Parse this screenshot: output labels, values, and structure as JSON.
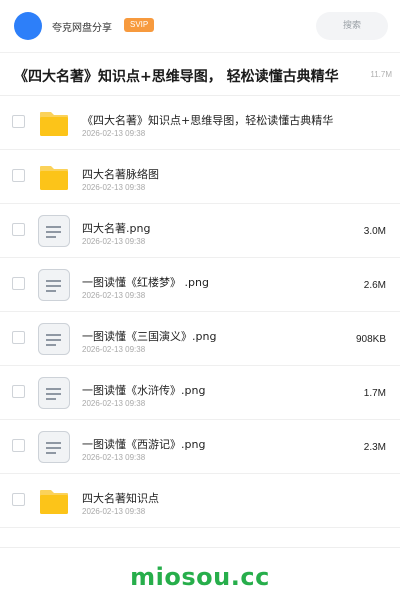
{
  "header": {
    "share_name": "夸克网盘分享",
    "badge": "SVIP",
    "search_label": "搜索"
  },
  "title": {
    "text": "《四大名著》知识点+思维导图， 轻松读懂古典精华",
    "size": "11.7M"
  },
  "files": [
    {
      "type": "folder",
      "name": "《四大名著》知识点+思维导图，轻松读懂古典精华",
      "date": "2026-02-13 09:38",
      "size": ""
    },
    {
      "type": "folder",
      "name": "四大名著脉络图",
      "date": "2026-02-13 09:38",
      "size": ""
    },
    {
      "type": "file",
      "name": "四大名著.png",
      "date": "2026-02-13 09:38",
      "size": "3.0M"
    },
    {
      "type": "file",
      "name": "一图读懂《红楼梦》 .png",
      "date": "2026-02-13 09:38",
      "size": "2.6M"
    },
    {
      "type": "file",
      "name": "一图读懂《三国演义》.png",
      "date": "2026-02-13 09:38",
      "size": "908KB"
    },
    {
      "type": "file",
      "name": "一图读懂《水浒传》.png",
      "date": "2026-02-13 09:38",
      "size": "1.7M"
    },
    {
      "type": "file",
      "name": "一图读懂《西游记》.png",
      "date": "2026-02-13 09:38",
      "size": "2.3M"
    },
    {
      "type": "folder",
      "name": "四大名著知识点",
      "date": "2026-02-13 09:38",
      "size": ""
    }
  ],
  "icons": {
    "folder": "folder-icon",
    "file": "document-icon"
  },
  "colors": {
    "accent": "#2d7ff9",
    "badge": "#f79a3e",
    "folder": "#fcc419",
    "watermark": "#27ae4b"
  },
  "watermark": "miosou.cc"
}
